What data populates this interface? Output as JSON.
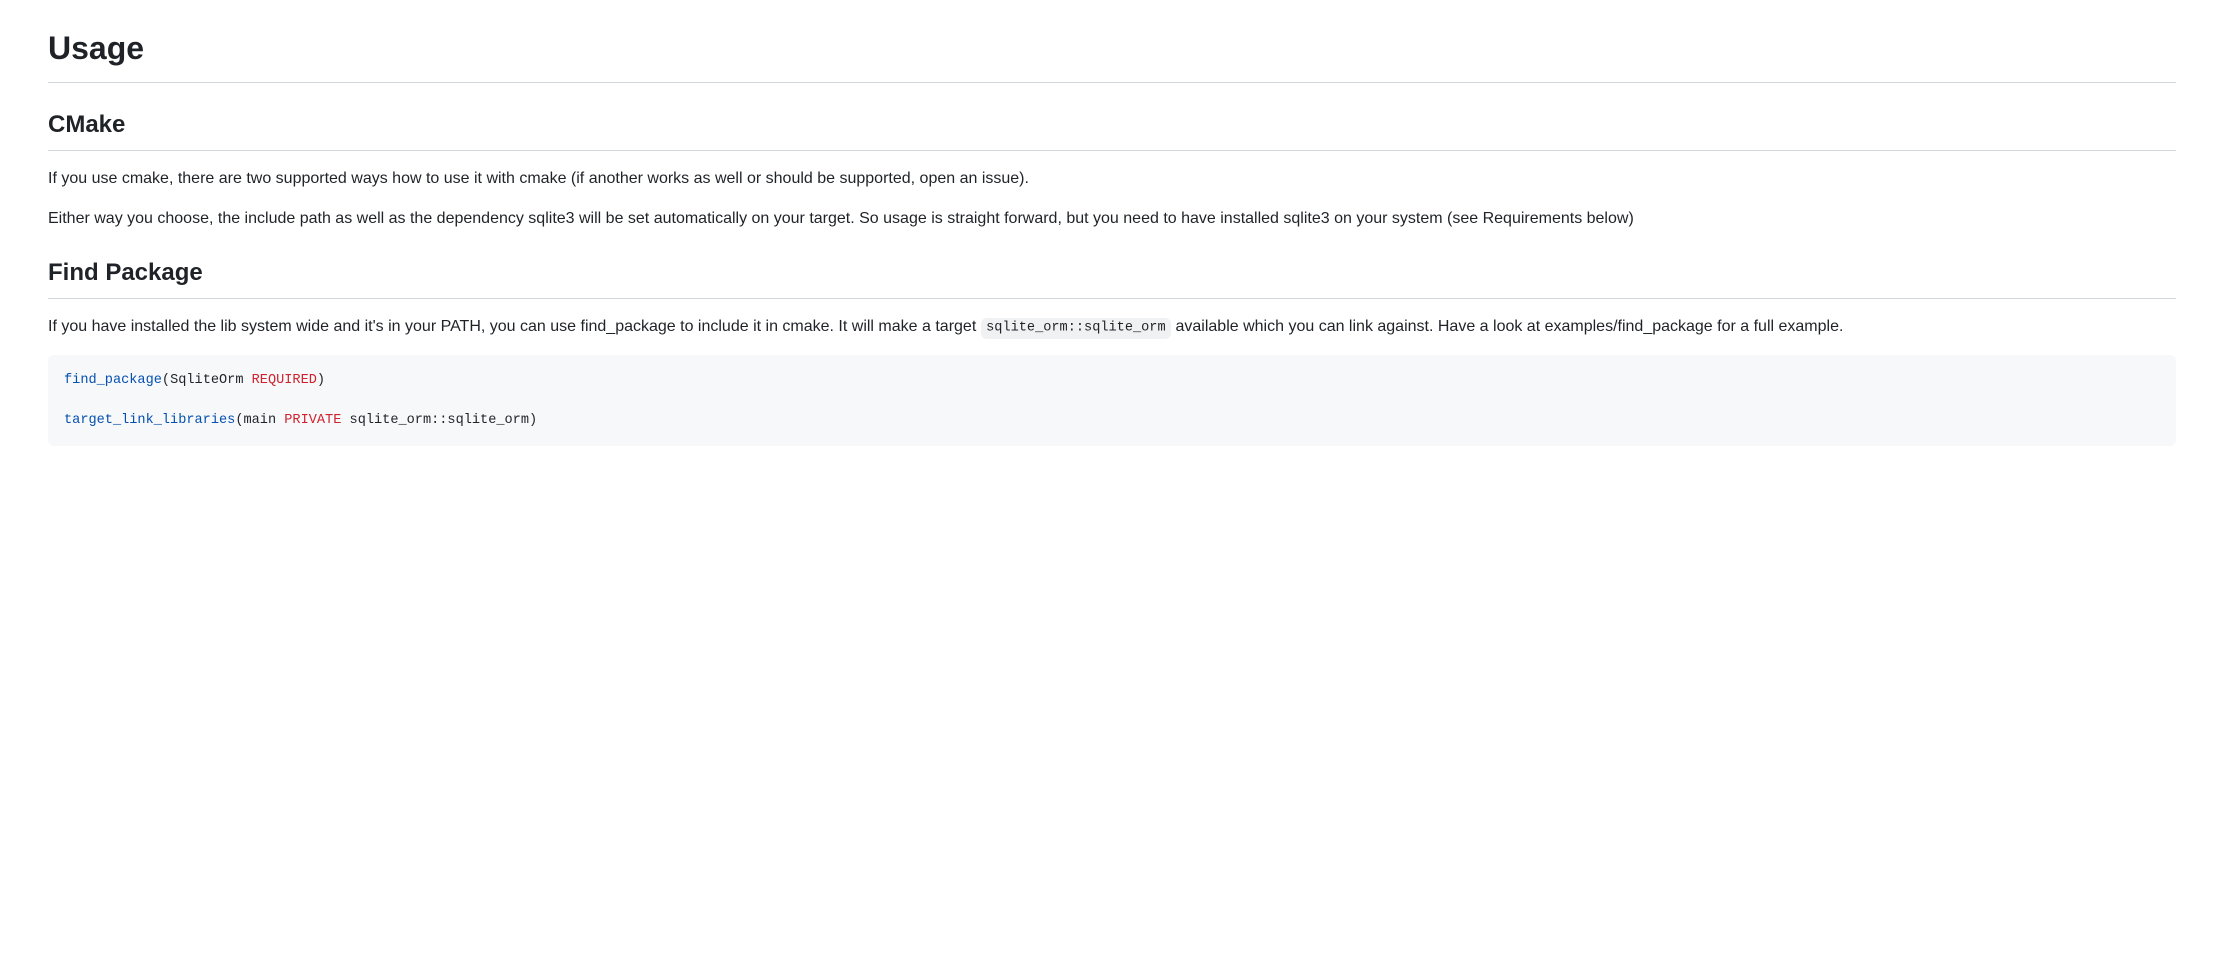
{
  "h1": "Usage",
  "h2_cmake": "CMake",
  "p_cmake_1": "If you use cmake, there are two supported ways how to use it with cmake (if another works as well or should be supported, open an issue).",
  "p_cmake_2": "Either way you choose, the include path as well as the dependency sqlite3 will be set automatically on your target. So usage is straight forward, but you need to have installed sqlite3 on your system (see Requirements below)",
  "h2_findpkg": "Find Package",
  "p_findpkg_pre": "If you have installed the lib system wide and it's in your PATH, you can use find_package to include it in cmake. It will make a target ",
  "p_findpkg_code": "sqlite_orm::sqlite_orm",
  "p_findpkg_post": " available which you can link against. Have a look at examples/find_package for a full example.",
  "code": {
    "find_package": "find_package",
    "open1": "(SqliteOrm ",
    "required": "REQUIRED",
    "close1": ")",
    "tll": "target_link_libraries",
    "open2": "(main ",
    "private": "PRIVATE",
    "close2": " sqlite_orm::sqlite_orm)"
  }
}
